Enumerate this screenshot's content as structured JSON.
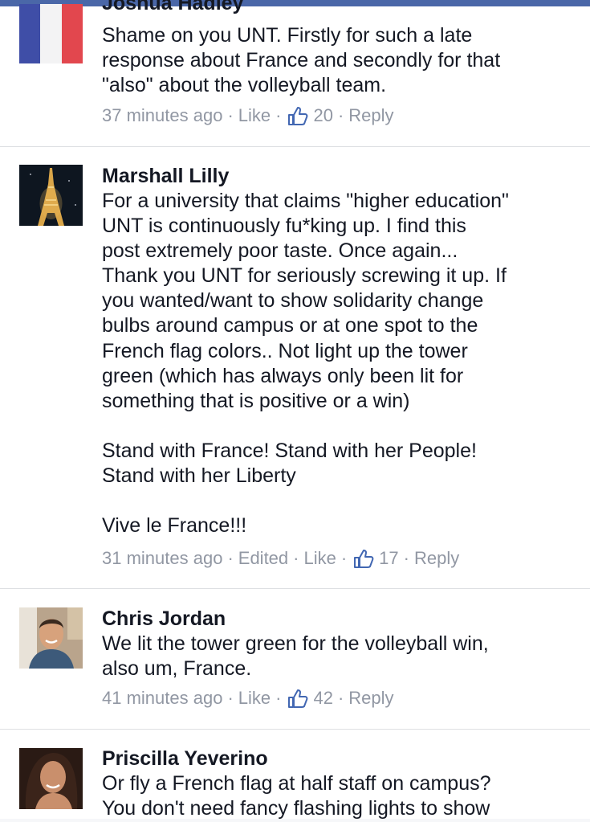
{
  "comments": [
    {
      "name": "Joshua Hadley",
      "avatar": "french-flag-avatar",
      "lines": [
        "Shame on you UNT. Firstly for such a late",
        "response about France and secondly for that",
        "\"also\" about the volleyball team."
      ],
      "time": "37 minutes ago",
      "edited": "",
      "like_label": "Like",
      "like_count": "20",
      "reply_label": "Reply"
    },
    {
      "name": "Marshall Lilly",
      "avatar": "eiffel-tower-avatar",
      "lines": [
        "For a university that claims \"higher education\"",
        "UNT is continuously fu*king up. I find this",
        "post extremely poor taste. Once again...",
        "Thank you UNT for seriously screwing it up. If",
        "you wanted/want to show solidarity change",
        "bulbs around campus or at one spot to the",
        "French flag colors.. Not light up the tower",
        "green (which has always only been lit for",
        "something that is positive or a win)",
        "",
        "Stand with France! Stand with her People!",
        "Stand with her Liberty",
        "",
        "Vive le France!!!"
      ],
      "time": "31 minutes ago",
      "edited": "Edited",
      "like_label": "Like",
      "like_count": "17",
      "reply_label": "Reply"
    },
    {
      "name": "Chris Jordan",
      "avatar": "profile-photo-avatar",
      "lines": [
        "We lit the tower green for the volleyball win,",
        "also um, France."
      ],
      "time": "41 minutes ago",
      "edited": "",
      "like_label": "Like",
      "like_count": "42",
      "reply_label": "Reply"
    },
    {
      "name": "Priscilla Yeverino",
      "avatar": "profile-photo-avatar",
      "lines": [
        "Or fly a French flag at half staff on campus?",
        "You don't need fancy flashing lights to show"
      ],
      "time": "",
      "edited": "",
      "like_label": "",
      "like_count": "",
      "reply_label": ""
    }
  ],
  "colors": {
    "meta_text": "#9197a3",
    "link_blue": "#4267b2",
    "divider": "#dddfe2"
  },
  "icons": {
    "like": "thumbs-up-icon"
  }
}
